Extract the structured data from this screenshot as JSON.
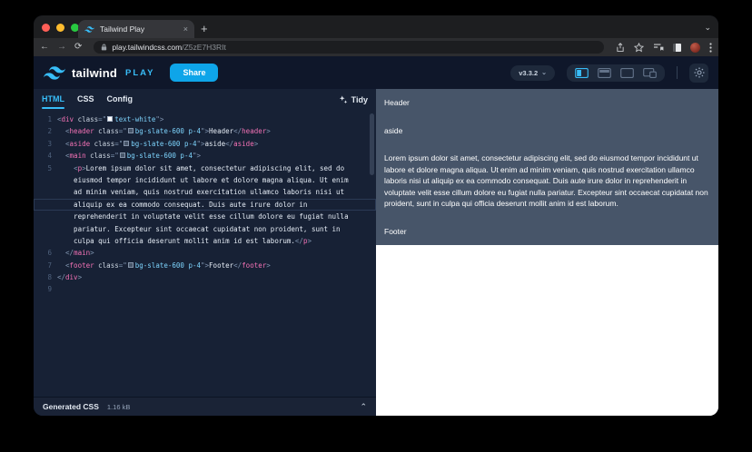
{
  "browser": {
    "tab_title": "Tailwind Play",
    "close_glyph": "×",
    "new_tab_glyph": "+",
    "back_glyph": "←",
    "forward_glyph": "→",
    "refresh_glyph": "⟳",
    "lock_glyph": "🔒",
    "url_host": "play.tailwindcss.com",
    "url_path": "/Z5zE7H3RIt",
    "action_icons": [
      "share",
      "bookmark-star",
      "reading-list",
      "side-panel",
      "profile-avatar",
      "overflow-menu"
    ]
  },
  "header": {
    "brand": "tailwind",
    "brand_suffix": "PLAY",
    "share_label": "Share",
    "version_label": "v3.3.2",
    "layout_icons": [
      "split-vertical",
      "split-horizontal",
      "preview-only",
      "responsive-mode"
    ],
    "theme_icon": "sun"
  },
  "editor_tabs": [
    {
      "label": "HTML",
      "active": true
    },
    {
      "label": "CSS",
      "active": false
    },
    {
      "label": "Config",
      "active": false
    }
  ],
  "tidy_label": "Tidy",
  "colors": {
    "accent_sky": "#38bdf8",
    "share_button": "#0ea5e9",
    "slate_600_swatch": "#475569",
    "white_swatch": "#ffffff",
    "tag_pink": "#f472b6",
    "class_value_sky": "#7dd3fc"
  },
  "editor": {
    "rows": [
      {
        "n": "1",
        "t": [
          [
            "p",
            "<"
          ],
          [
            "t",
            "div"
          ],
          [
            "x",
            " "
          ],
          [
            "a",
            "class"
          ],
          [
            "p",
            "=\""
          ],
          [
            "w",
            "#ffffff"
          ],
          [
            "s",
            "text-white"
          ],
          [
            "p",
            "\">"
          ]
        ]
      },
      {
        "n": "2",
        "t": [
          [
            "x",
            "  "
          ],
          [
            "p",
            "<"
          ],
          [
            "t",
            "header"
          ],
          [
            "x",
            " "
          ],
          [
            "a",
            "class"
          ],
          [
            "p",
            "=\""
          ],
          [
            "w",
            "#475569"
          ],
          [
            "s",
            "bg-slate-600 p-4"
          ],
          [
            "p",
            "\">"
          ],
          [
            "x",
            "Header"
          ],
          [
            "p",
            "</"
          ],
          [
            "t",
            "header"
          ],
          [
            "p",
            ">"
          ]
        ]
      },
      {
        "n": "3",
        "t": [
          [
            "x",
            "  "
          ],
          [
            "p",
            "<"
          ],
          [
            "t",
            "aside"
          ],
          [
            "x",
            " "
          ],
          [
            "a",
            "class"
          ],
          [
            "p",
            "=\""
          ],
          [
            "w",
            "#475569"
          ],
          [
            "s",
            "bg-slate-600 p-4"
          ],
          [
            "p",
            "\">"
          ],
          [
            "x",
            "aside"
          ],
          [
            "p",
            "</"
          ],
          [
            "t",
            "aside"
          ],
          [
            "p",
            ">"
          ]
        ]
      },
      {
        "n": "4",
        "t": [
          [
            "x",
            "  "
          ],
          [
            "p",
            "<"
          ],
          [
            "t",
            "main"
          ],
          [
            "x",
            " "
          ],
          [
            "a",
            "class"
          ],
          [
            "p",
            "=\""
          ],
          [
            "w",
            "#475569"
          ],
          [
            "s",
            "bg-slate-600 p-4"
          ],
          [
            "p",
            "\">"
          ]
        ]
      },
      {
        "n": "5",
        "t": [
          [
            "x",
            "    "
          ],
          [
            "p",
            "<"
          ],
          [
            "t",
            "p"
          ],
          [
            "p",
            ">"
          ],
          [
            "x",
            "Lorem ipsum dolor sit amet, consectetur adipiscing elit, sed do"
          ]
        ]
      },
      {
        "n": "",
        "t": [
          [
            "x",
            "    eiusmod tempor incididunt ut labore et dolore magna aliqua. Ut enim"
          ]
        ]
      },
      {
        "n": "",
        "t": [
          [
            "x",
            "    ad minim veniam, quis nostrud exercitation ullamco laboris nisi ut"
          ]
        ]
      },
      {
        "n": "",
        "cur": true,
        "t": [
          [
            "x",
            "    aliquip ex ea commodo consequat. Duis aute irure dolor in"
          ]
        ]
      },
      {
        "n": "",
        "t": [
          [
            "x",
            "    reprehenderit in voluptate velit esse cillum dolore eu fugiat nulla"
          ]
        ]
      },
      {
        "n": "",
        "t": [
          [
            "x",
            "    pariatur. Excepteur sint occaecat cupidatat non proident, sunt in"
          ]
        ]
      },
      {
        "n": "",
        "t": [
          [
            "x",
            "    culpa qui officia deserunt mollit anim id est laborum."
          ],
          [
            "p",
            "</"
          ],
          [
            "t",
            "p"
          ],
          [
            "p",
            ">"
          ]
        ]
      },
      {
        "n": "6",
        "t": [
          [
            "x",
            "  "
          ],
          [
            "p",
            "</"
          ],
          [
            "t",
            "main"
          ],
          [
            "p",
            ">"
          ]
        ]
      },
      {
        "n": "7",
        "t": [
          [
            "x",
            "  "
          ],
          [
            "p",
            "<"
          ],
          [
            "t",
            "footer"
          ],
          [
            "x",
            " "
          ],
          [
            "a",
            "class"
          ],
          [
            "p",
            "=\""
          ],
          [
            "w",
            "#475569"
          ],
          [
            "s",
            "bg-slate-600 p-4"
          ],
          [
            "p",
            "\">"
          ],
          [
            "x",
            "Footer"
          ],
          [
            "p",
            "</"
          ],
          [
            "t",
            "footer"
          ],
          [
            "p",
            ">"
          ]
        ]
      },
      {
        "n": "8",
        "t": [
          [
            "p",
            "</"
          ],
          [
            "t",
            "div"
          ],
          [
            "p",
            ">"
          ]
        ]
      },
      {
        "n": "9",
        "t": []
      }
    ]
  },
  "statusbar": {
    "label": "Generated CSS",
    "size": "1.16 kB"
  },
  "preview": {
    "block_color": "#475569",
    "header_text": "Header",
    "aside_text": "aside",
    "paragraph": "Lorem ipsum dolor sit amet, consectetur adipiscing elit, sed do eiusmod tempor incididunt ut labore et dolore magna aliqua. Ut enim ad minim veniam, quis nostrud exercitation ullamco laboris nisi ut aliquip ex ea commodo consequat. Duis aute irure dolor in reprehenderit in voluptate velit esse cillum dolore eu fugiat nulla pariatur. Excepteur sint occaecat cupidatat non proident, sunt in culpa qui officia deserunt mollit anim id est laborum.",
    "footer_text": "Footer"
  }
}
